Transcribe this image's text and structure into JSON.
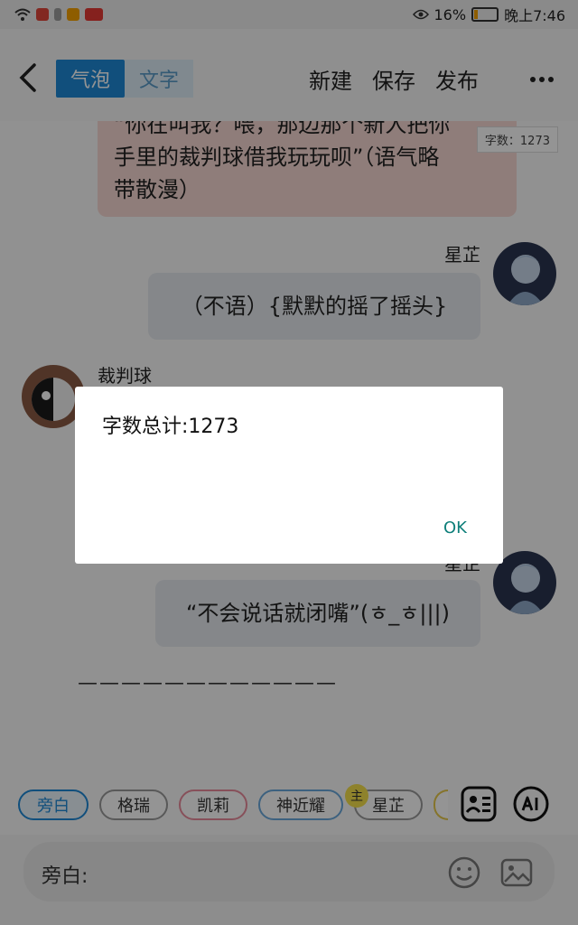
{
  "status_bar": {
    "battery": "16%",
    "time": "晚上7:46"
  },
  "header": {
    "tabs": [
      {
        "label": "气泡",
        "active": true
      },
      {
        "label": "文字",
        "active": false
      }
    ],
    "actions": [
      "新建",
      "保存",
      "发布"
    ]
  },
  "word_count_badge": "字数：1273",
  "messages": [
    {
      "type": "pink-bubble",
      "lines": [
        "“你在叫我？喂，那边那个新人把你",
        "手里的裁判球借我玩玩呗”（语气略",
        "带散漫）"
      ]
    },
    {
      "speaker": "星芷",
      "text": "（不语）{默默的摇了摇头}"
    },
    {
      "speaker": "裁判球"
    },
    {
      "speaker": "星芷",
      "text": "“不会说话就闭嘴”(ㅎ_ㅎ|||)"
    }
  ],
  "divider_text": "————————————",
  "chips": [
    "旁白",
    "格瑞",
    "凯莉",
    "神近耀",
    "星芷"
  ],
  "chip_badge": "主",
  "input": {
    "label": "旁白:"
  },
  "dialog": {
    "message": "字数总计:1273",
    "ok_label": "OK"
  },
  "colors": {
    "accent": "#1e88d6",
    "dialog_ok": "#0e7f7a",
    "pink_bubble": "#f6d8d2",
    "grey_bubble": "#e5e9ee"
  }
}
